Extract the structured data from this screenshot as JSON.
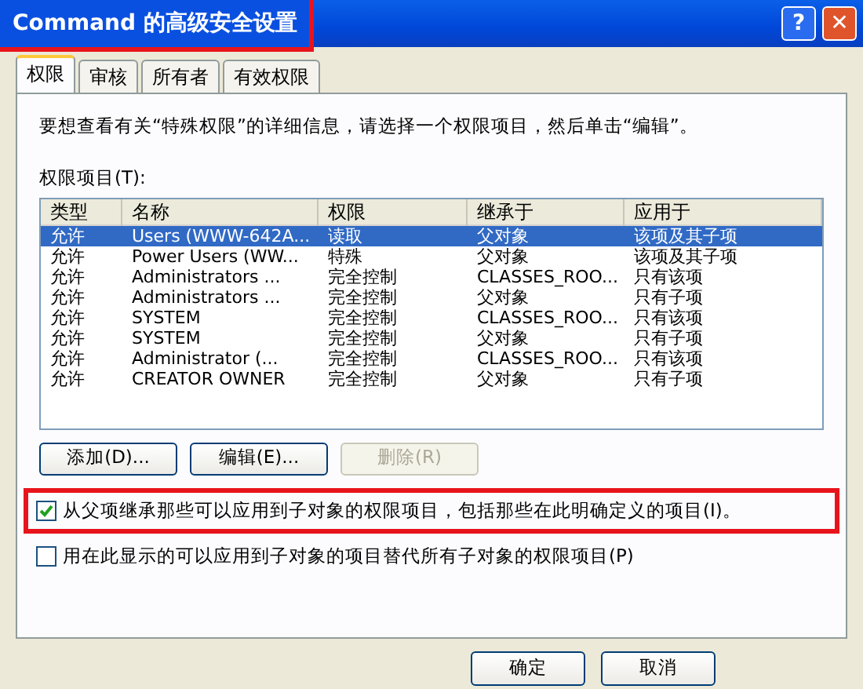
{
  "window": {
    "title": "Command 的高级安全设置",
    "title_highlighted": true
  },
  "title_buttons": [
    {
      "kind": "help",
      "label": "?"
    },
    {
      "kind": "close",
      "label": "✕"
    }
  ],
  "tabs": [
    {
      "label": "权限",
      "selected": true
    },
    {
      "label": "审核",
      "selected": false
    },
    {
      "label": "所有者",
      "selected": false
    },
    {
      "label": "有效权限",
      "selected": false
    }
  ],
  "intro": "要想查看有关“特殊权限”的详细信息，请选择一个权限项目，然后单击“编辑”。",
  "list_label": "权限项目(T):",
  "table": {
    "columns": [
      "类型",
      "名称",
      "权限",
      "继承于",
      "应用于"
    ],
    "rows": [
      {
        "cells": [
          "允许",
          "Users (WWW-642A...",
          "读取",
          "父对象",
          "该项及其子项"
        ],
        "selected": true
      },
      {
        "cells": [
          "允许",
          "Power Users (WW...",
          "特殊",
          "父对象",
          "该项及其子项"
        ],
        "selected": false
      },
      {
        "cells": [
          "允许",
          "Administrators ...",
          "完全控制",
          "CLASSES_ROO...",
          "只有该项"
        ],
        "selected": false
      },
      {
        "cells": [
          "允许",
          "Administrators ...",
          "完全控制",
          "父对象",
          "只有子项"
        ],
        "selected": false
      },
      {
        "cells": [
          "允许",
          "SYSTEM",
          "完全控制",
          "CLASSES_ROO...",
          "只有该项"
        ],
        "selected": false
      },
      {
        "cells": [
          "允许",
          "SYSTEM",
          "完全控制",
          "父对象",
          "只有子项"
        ],
        "selected": false
      },
      {
        "cells": [
          "允许",
          "Administrator (...",
          "完全控制",
          "CLASSES_ROO...",
          "只有该项"
        ],
        "selected": false
      },
      {
        "cells": [
          "允许",
          "CREATOR OWNER",
          "完全控制",
          "父对象",
          "只有子项"
        ],
        "selected": false
      }
    ]
  },
  "list_buttons": [
    {
      "label": "添加(D)...",
      "disabled": false
    },
    {
      "label": "编辑(E)...",
      "disabled": false
    },
    {
      "label": "删除(R)",
      "disabled": true
    }
  ],
  "options": [
    {
      "label": "从父项继承那些可以应用到子对象的权限项目，包括那些在此明确定义的项目(I)。",
      "checked": true,
      "highlighted": true
    },
    {
      "label": "用在此显示的可以应用到子对象的项目替代所有子对象的权限项目(P)",
      "checked": false,
      "highlighted": false
    }
  ],
  "footer_buttons": [
    {
      "label": "确定"
    },
    {
      "label": "取消"
    }
  ]
}
